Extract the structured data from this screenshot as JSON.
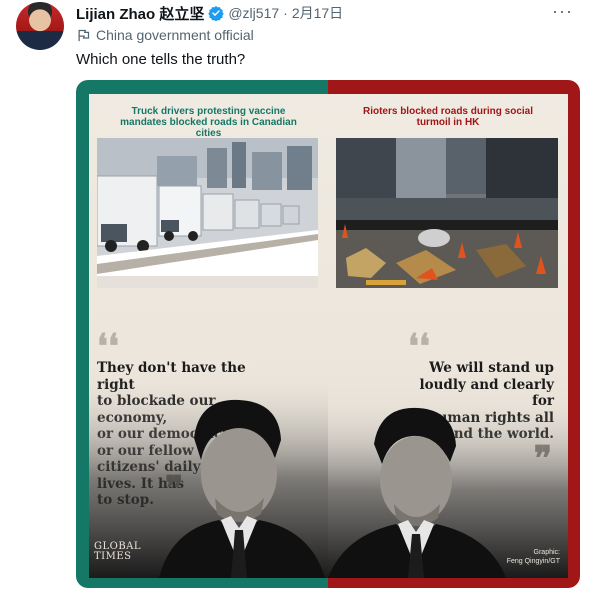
{
  "tweet": {
    "author_name": "Lijian Zhao 赵立坚",
    "handle": "@zlj517",
    "separator": "·",
    "date": "2月17日",
    "more_label": "···",
    "account_label": "China government official",
    "text": "Which one tells the truth?"
  },
  "graphic": {
    "left": {
      "caption": "Truck drivers protesting vaccine mandates blocked roads in Canadian cities",
      "open_quote": "❛❛",
      "quote_lines": [
        "They don't have the right",
        "to blockade our economy,",
        "or our democracy,",
        "or our fellow",
        "citizens' daily",
        "lives. It has",
        "to stop."
      ],
      "close_quote": "❞"
    },
    "right": {
      "caption": "Rioters blocked roads during social turmoil in HK",
      "open_quote": "❛❛",
      "quote_lines": [
        "We will stand up",
        "loudly and clearly for",
        "human rights all",
        "around the world."
      ],
      "close_quote": "❞"
    },
    "logo": "GLOBAL TIMES",
    "credit_lines": [
      "Graphic:",
      "Feng Qingyin/GT"
    ]
  },
  "colors": {
    "left_border": "#157766",
    "right_border": "#a11616",
    "verified_blue": "#1d9bf0",
    "muted_text": "#536471"
  },
  "icons": {
    "verified": "verified-badge-icon",
    "more": "more-options-icon",
    "flag": "government-label-flag-icon"
  }
}
